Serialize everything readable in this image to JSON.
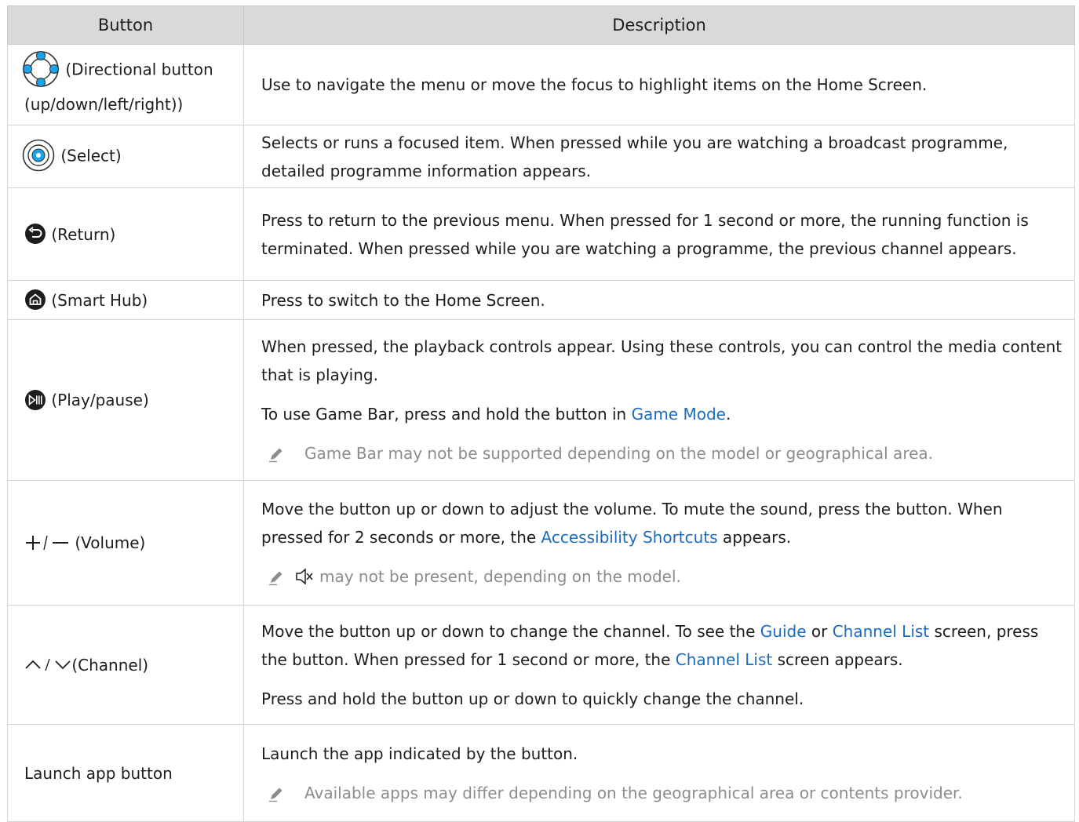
{
  "table": {
    "headers": {
      "button": "Button",
      "description": "Description"
    },
    "rows": [
      {
        "button_label": "(Directional button",
        "button_label_2": "(up/down/left/right))",
        "icon": "directional-pad-icon",
        "description": "Use to navigate the menu or move the focus to highlight items on the Home Screen."
      },
      {
        "button_label": "(Select)",
        "icon": "select-button-icon",
        "description": "Selects or runs a focused item. When pressed while you are watching a broadcast programme, detailed programme information appears."
      },
      {
        "button_label": "(Return)",
        "icon": "return-icon",
        "description": "Press to return to the previous menu. When pressed for 1 second or more, the running function is terminated. When pressed while you are watching a programme, the previous channel appears."
      },
      {
        "button_label": "(Smart Hub)",
        "icon": "home-icon",
        "description": "Press to switch to the Home Screen."
      },
      {
        "button_label": "(Play/pause)",
        "icon": "play-pause-icon",
        "description": "When pressed, the playback controls appear. Using these controls, you can control the media content that is playing.",
        "description_2_pre": "To use Game Bar, press and hold the button in ",
        "description_2_link": "Game Mode",
        "description_2_post": ".",
        "note": "Game Bar may not be supported depending on the model or geographical area."
      },
      {
        "button_label": "(Volume)",
        "icon": "volume-plus-minus-icon",
        "description_pre": "Move the button up or down to adjust the volume. To mute the sound, press the button. When pressed for 2 seconds or more, the ",
        "description_link": "Accessibility Shortcuts",
        "description_post": " appears.",
        "note": "may not be present, depending on the model.",
        "note_icon": "mute-icon"
      },
      {
        "button_label": "(Channel)",
        "icon": "channel-up-down-icon",
        "description_a": "Move the button up or down to change the channel. To see the ",
        "description_link_1": "Guide",
        "description_b": " or ",
        "description_link_2": "Channel List",
        "description_c": " screen, press the button. When pressed for 1 second or more, the ",
        "description_link_3": "Channel List",
        "description_d": " screen appears.",
        "description_2": "Press and hold the button up or down to quickly change the channel."
      },
      {
        "button_label": "Launch app button",
        "description": "Launch the app indicated by the button.",
        "note": "Available apps may differ depending on the geographical area or contents provider."
      }
    ]
  },
  "colors": {
    "header_bg": "#d9d9d9",
    "link": "#1a6cc2",
    "note_text": "#8c8c8c",
    "icon_blue": "#1aa3e8"
  },
  "note_icon": "pencil-icon"
}
